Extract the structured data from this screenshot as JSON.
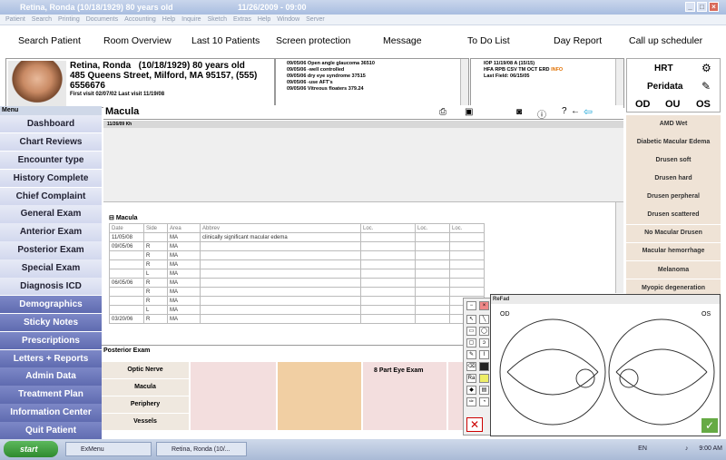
{
  "titlebar": {
    "title": "Retina, Ronda  (10/18/1929)  80 years old",
    "datetime": "11/26/2009 - 09:00"
  },
  "menubar": [
    "Patient",
    "Search",
    "Printing",
    "Documents",
    "Accounting",
    "Help",
    "Inquire",
    "Sketch",
    "Extras",
    "Help",
    "Window",
    "Server"
  ],
  "nav": [
    "Search Patient",
    "Room Overview",
    "Last 10 Patients",
    "Screen protection",
    "Message",
    "To Do List",
    "Day Report",
    "Call up scheduler"
  ],
  "patient": {
    "name": "Retina, Ronda",
    "dob": "(10/18/1929) 80 years old",
    "address": "485 Queens Street, Milford, MA 95157, (555)",
    "phone": "6556676",
    "visits": "First visit 02/07/02   Last visit 11/19/08"
  },
  "diagnoses": [
    "09/05/06 Open angle glaucoma  36510",
    "09/05/06 -well controlled",
    "09/05/06 dry eye syndrome  37515",
    "09/05/06 -use AFT's",
    "09/05/06 Vitreous floaters  379.24"
  ],
  "iop": {
    "line1": "IOP 11/19/08 A (15/15)",
    "line2": "HFA RPB CSV TM OCT ERD",
    "info": "INFO",
    "line3": "Last Field: 06/15/05"
  },
  "hrt": {
    "hrt": "HRT",
    "peridata": "Peridata",
    "od": "OD",
    "ou": "OU",
    "os": "OS"
  },
  "menu": {
    "header": "Menu",
    "items": [
      "Dashboard",
      "Chart Reviews",
      "Encounter type",
      "History Complete",
      "Chief Complaint",
      "General Exam",
      "Anterior Exam",
      "Posterior Exam",
      "Special Exam",
      "Diagnosis ICD",
      "Demographics",
      "Sticky Notes",
      "Prescriptions",
      "Letters + Reports",
      "Admin Data",
      "Treatment Plan",
      "Information Center",
      "Quit Patient"
    ]
  },
  "macula": {
    "title": "Macula",
    "date": "11/26/09 Kh",
    "section": "Macula",
    "columns": [
      "Date",
      "Side",
      "Area",
      "Abbrev",
      "Loc.",
      "Loc.",
      "Loc."
    ],
    "rows": [
      [
        "11/05/08",
        "",
        "MA",
        "clinically significant macular edema"
      ],
      [
        "09/05/06",
        "R",
        "MA",
        ""
      ],
      [
        "",
        "R",
        "MA",
        ""
      ],
      [
        "",
        "R",
        "MA",
        ""
      ],
      [
        "",
        "L",
        "MA",
        ""
      ],
      [
        "06/05/06",
        "R",
        "MA",
        ""
      ],
      [
        "",
        "R",
        "MA",
        ""
      ],
      [
        "",
        "R",
        "MA",
        ""
      ],
      [
        "",
        "L",
        "MA",
        ""
      ],
      [
        "03/20/06",
        "R",
        "MA",
        ""
      ]
    ]
  },
  "rightlist": [
    "AMD Wet",
    "Diabetic Macular Edema",
    "Drusen soft",
    "Drusen hard",
    "Drusen perpheral",
    "Drusen scattered",
    "No Macular Drusen",
    "Macular hemorrhage",
    "Melanoma",
    "Myopic degeneration"
  ],
  "posterior": {
    "title": "Posterior Exam",
    "rows": [
      "Optic Nerve",
      "Macula",
      "Periphery",
      "Vessels"
    ],
    "eightpart": "8 Part Eye Exam"
  },
  "sketch": {
    "title": "ReFad",
    "od": "OD",
    "os": "OS"
  },
  "taskbar": {
    "start": "start",
    "tasks": [
      "ExMenu",
      "Retina, Ronda   (10/..."
    ],
    "lang": "EN",
    "time": "9:00 AM"
  }
}
